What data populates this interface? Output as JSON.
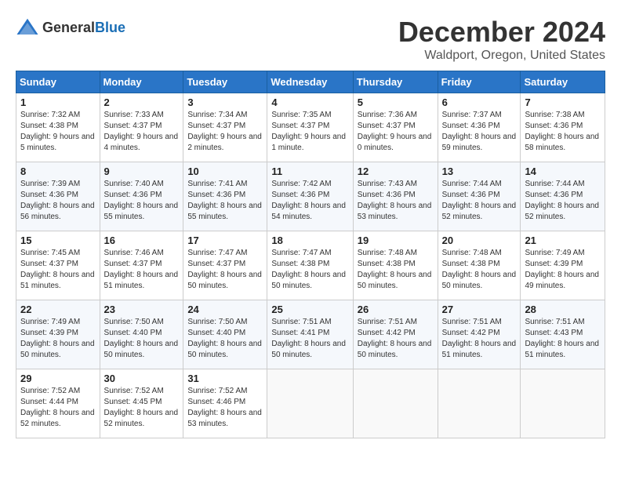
{
  "header": {
    "logo_general": "General",
    "logo_blue": "Blue",
    "month": "December 2024",
    "location": "Waldport, Oregon, United States"
  },
  "weekdays": [
    "Sunday",
    "Monday",
    "Tuesday",
    "Wednesday",
    "Thursday",
    "Friday",
    "Saturday"
  ],
  "weeks": [
    [
      {
        "day": "1",
        "sunrise": "7:32 AM",
        "sunset": "4:38 PM",
        "daylight": "9 hours and 5 minutes."
      },
      {
        "day": "2",
        "sunrise": "7:33 AM",
        "sunset": "4:37 PM",
        "daylight": "9 hours and 4 minutes."
      },
      {
        "day": "3",
        "sunrise": "7:34 AM",
        "sunset": "4:37 PM",
        "daylight": "9 hours and 2 minutes."
      },
      {
        "day": "4",
        "sunrise": "7:35 AM",
        "sunset": "4:37 PM",
        "daylight": "9 hours and 1 minute."
      },
      {
        "day": "5",
        "sunrise": "7:36 AM",
        "sunset": "4:37 PM",
        "daylight": "9 hours and 0 minutes."
      },
      {
        "day": "6",
        "sunrise": "7:37 AM",
        "sunset": "4:36 PM",
        "daylight": "8 hours and 59 minutes."
      },
      {
        "day": "7",
        "sunrise": "7:38 AM",
        "sunset": "4:36 PM",
        "daylight": "8 hours and 58 minutes."
      }
    ],
    [
      {
        "day": "8",
        "sunrise": "7:39 AM",
        "sunset": "4:36 PM",
        "daylight": "8 hours and 56 minutes."
      },
      {
        "day": "9",
        "sunrise": "7:40 AM",
        "sunset": "4:36 PM",
        "daylight": "8 hours and 55 minutes."
      },
      {
        "day": "10",
        "sunrise": "7:41 AM",
        "sunset": "4:36 PM",
        "daylight": "8 hours and 55 minutes."
      },
      {
        "day": "11",
        "sunrise": "7:42 AM",
        "sunset": "4:36 PM",
        "daylight": "8 hours and 54 minutes."
      },
      {
        "day": "12",
        "sunrise": "7:43 AM",
        "sunset": "4:36 PM",
        "daylight": "8 hours and 53 minutes."
      },
      {
        "day": "13",
        "sunrise": "7:44 AM",
        "sunset": "4:36 PM",
        "daylight": "8 hours and 52 minutes."
      },
      {
        "day": "14",
        "sunrise": "7:44 AM",
        "sunset": "4:36 PM",
        "daylight": "8 hours and 52 minutes."
      }
    ],
    [
      {
        "day": "15",
        "sunrise": "7:45 AM",
        "sunset": "4:37 PM",
        "daylight": "8 hours and 51 minutes."
      },
      {
        "day": "16",
        "sunrise": "7:46 AM",
        "sunset": "4:37 PM",
        "daylight": "8 hours and 51 minutes."
      },
      {
        "day": "17",
        "sunrise": "7:47 AM",
        "sunset": "4:37 PM",
        "daylight": "8 hours and 50 minutes."
      },
      {
        "day": "18",
        "sunrise": "7:47 AM",
        "sunset": "4:38 PM",
        "daylight": "8 hours and 50 minutes."
      },
      {
        "day": "19",
        "sunrise": "7:48 AM",
        "sunset": "4:38 PM",
        "daylight": "8 hours and 50 minutes."
      },
      {
        "day": "20",
        "sunrise": "7:48 AM",
        "sunset": "4:38 PM",
        "daylight": "8 hours and 50 minutes."
      },
      {
        "day": "21",
        "sunrise": "7:49 AM",
        "sunset": "4:39 PM",
        "daylight": "8 hours and 49 minutes."
      }
    ],
    [
      {
        "day": "22",
        "sunrise": "7:49 AM",
        "sunset": "4:39 PM",
        "daylight": "8 hours and 50 minutes."
      },
      {
        "day": "23",
        "sunrise": "7:50 AM",
        "sunset": "4:40 PM",
        "daylight": "8 hours and 50 minutes."
      },
      {
        "day": "24",
        "sunrise": "7:50 AM",
        "sunset": "4:40 PM",
        "daylight": "8 hours and 50 minutes."
      },
      {
        "day": "25",
        "sunrise": "7:51 AM",
        "sunset": "4:41 PM",
        "daylight": "8 hours and 50 minutes."
      },
      {
        "day": "26",
        "sunrise": "7:51 AM",
        "sunset": "4:42 PM",
        "daylight": "8 hours and 50 minutes."
      },
      {
        "day": "27",
        "sunrise": "7:51 AM",
        "sunset": "4:42 PM",
        "daylight": "8 hours and 51 minutes."
      },
      {
        "day": "28",
        "sunrise": "7:51 AM",
        "sunset": "4:43 PM",
        "daylight": "8 hours and 51 minutes."
      }
    ],
    [
      {
        "day": "29",
        "sunrise": "7:52 AM",
        "sunset": "4:44 PM",
        "daylight": "8 hours and 52 minutes."
      },
      {
        "day": "30",
        "sunrise": "7:52 AM",
        "sunset": "4:45 PM",
        "daylight": "8 hours and 52 minutes."
      },
      {
        "day": "31",
        "sunrise": "7:52 AM",
        "sunset": "4:46 PM",
        "daylight": "8 hours and 53 minutes."
      },
      null,
      null,
      null,
      null
    ]
  ]
}
